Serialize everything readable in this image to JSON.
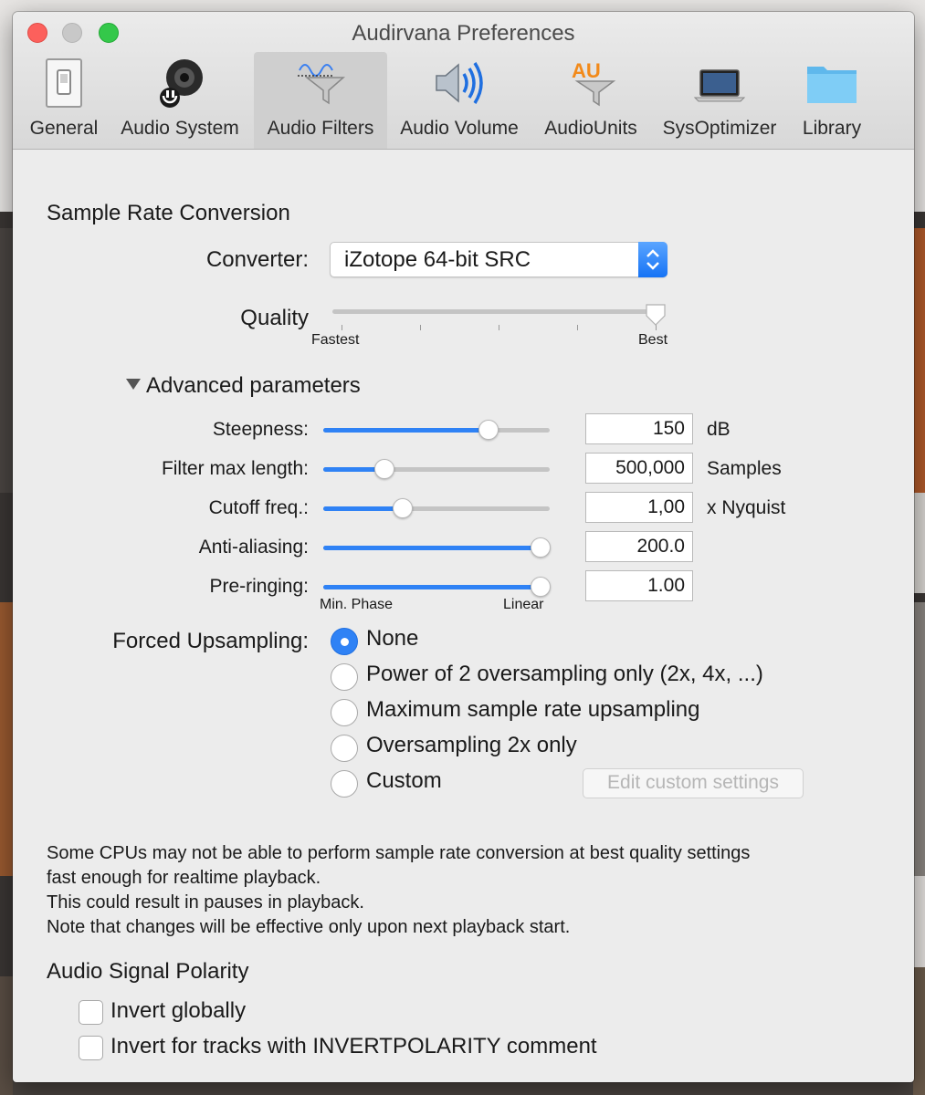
{
  "window": {
    "title": "Audirvana Preferences"
  },
  "toolbar": {
    "items": [
      {
        "label": "General",
        "icon": "light-switch-icon"
      },
      {
        "label": "Audio System",
        "icon": "speaker-icon"
      },
      {
        "label": "Audio Filters",
        "icon": "audio-filter-funnel-icon",
        "selected": true
      },
      {
        "label": "Audio Volume",
        "icon": "volume-speaker-icon"
      },
      {
        "label": "AudioUnits",
        "icon": "audiounits-funnel-icon"
      },
      {
        "label": "SysOptimizer",
        "icon": "laptop-icon"
      },
      {
        "label": "Library",
        "icon": "folder-icon"
      }
    ]
  },
  "src": {
    "section_title": "Sample Rate Conversion",
    "converter_label": "Converter:",
    "converter_value": "iZotope 64-bit SRC",
    "quality_label": "Quality",
    "quality_min_label": "Fastest",
    "quality_max_label": "Best",
    "quality_level": 1.0
  },
  "advanced": {
    "title": "Advanced parameters",
    "params": [
      {
        "label": "Steepness:",
        "value": "150",
        "unit": "dB",
        "level": 0.73
      },
      {
        "label": "Filter max length:",
        "value": "500,000",
        "unit": "Samples",
        "level": 0.27
      },
      {
        "label": "Cutoff freq.:",
        "value": "1,00",
        "unit": "x Nyquist",
        "level": 0.35
      },
      {
        "label": "Anti-aliasing:",
        "value": "200.0",
        "unit": "",
        "level": 1.0
      },
      {
        "label": "Pre-ringing:",
        "value": "1.00",
        "unit": "",
        "level": 1.0
      }
    ],
    "prering_min_label": "Min. Phase",
    "prering_max_label": "Linear"
  },
  "upsampling": {
    "label": "Forced  Upsampling:",
    "options": [
      {
        "label": "None",
        "selected": true
      },
      {
        "label": "Power of 2 oversampling only (2x, 4x, ...)",
        "selected": false
      },
      {
        "label": "Maximum sample rate upsampling",
        "selected": false
      },
      {
        "label": "Oversampling 2x only",
        "selected": false
      },
      {
        "label": "Custom",
        "selected": false
      }
    ],
    "edit_custom_label": "Edit custom settings"
  },
  "note": {
    "line1": "Some CPUs may not be able to perform sample rate conversion at best quality settings",
    "line2": "fast enough for realtime playback.",
    "line3": "This could result in pauses in playback.",
    "line4": "Note that changes will be effective only upon next playback start."
  },
  "polarity": {
    "section_title": "Audio Signal Polarity",
    "invert_globally_label": "Invert globally",
    "invert_globally_checked": false,
    "invert_tracks_label": "Invert for tracks with INVERTPOLARITY comment",
    "invert_tracks_checked": false
  },
  "colors": {
    "accent": "#2f82f5",
    "close": "#fc605c",
    "zoom": "#34c84a"
  }
}
